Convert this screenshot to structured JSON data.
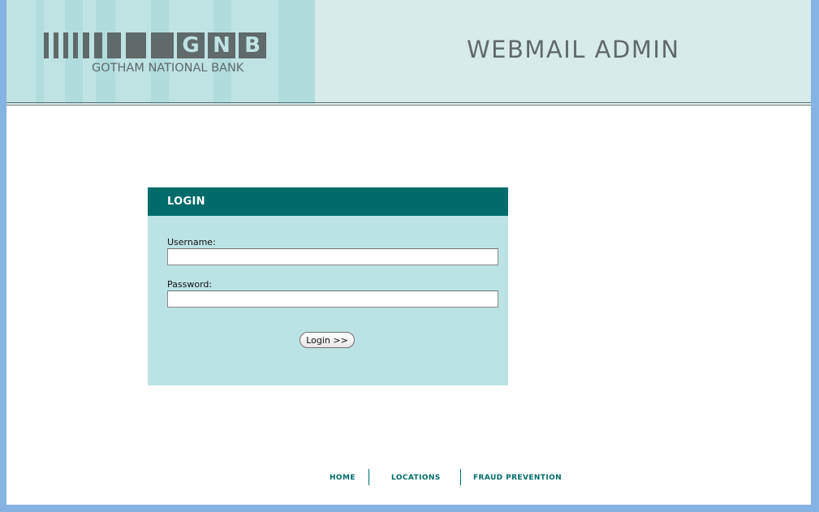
{
  "header": {
    "logo": {
      "letters": [
        "G",
        "N",
        "B"
      ],
      "bank_name": "GOTHAM NATIONAL BANK"
    },
    "title": "WEBMAIL ADMIN"
  },
  "login": {
    "title": "LOGIN",
    "username_label": "Username:",
    "username_value": "",
    "password_label": "Password:",
    "password_value": "",
    "submit_label": "Login >>"
  },
  "footer": {
    "links": [
      "HOME",
      "LOCATIONS",
      "FRAUD PREVENTION"
    ]
  },
  "colors": {
    "page_background": "#85b3e3",
    "header_background": "#d8ebeb",
    "logo_panel": "#bfe3e3",
    "login_header": "#006b6b",
    "login_body": "#bce3e3",
    "logo_gray": "#5f6a6b",
    "link_teal": "#006b6b"
  }
}
